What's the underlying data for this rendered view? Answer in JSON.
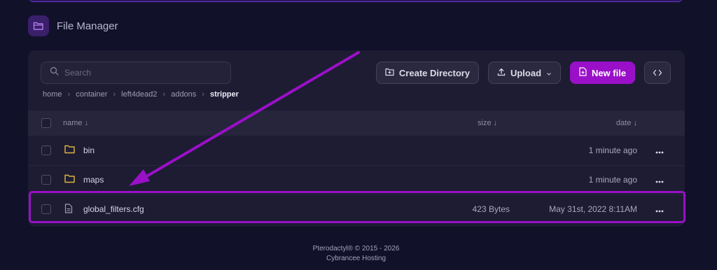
{
  "header": {
    "title": "File Manager",
    "icon": "folder-icon"
  },
  "search": {
    "placeholder": "Search"
  },
  "toolbar": {
    "create_directory": "Create Directory",
    "upload": "Upload",
    "new_file": "New file"
  },
  "breadcrumb": [
    "home",
    "container",
    "left4dead2",
    "addons",
    "stripper"
  ],
  "table": {
    "headers": {
      "name": "name ↓",
      "size": "size ↓",
      "date": "date ↓"
    },
    "rows": [
      {
        "type": "folder",
        "name": "bin",
        "size": "",
        "date": "1 minute ago"
      },
      {
        "type": "folder",
        "name": "maps",
        "size": "",
        "date": "1 minute ago"
      },
      {
        "type": "file",
        "name": "global_filters.cfg",
        "size": "423 Bytes",
        "date": "May 31st, 2022 8:11AM"
      }
    ]
  },
  "footer": {
    "line1": "Pterodactyl® © 2015 - 2026",
    "line2": "Cybrancee Hosting"
  },
  "colors": {
    "accent": "#9a10c8",
    "background": "#12112a",
    "panel": "#1d1c33",
    "folder": "#e2b53c"
  }
}
